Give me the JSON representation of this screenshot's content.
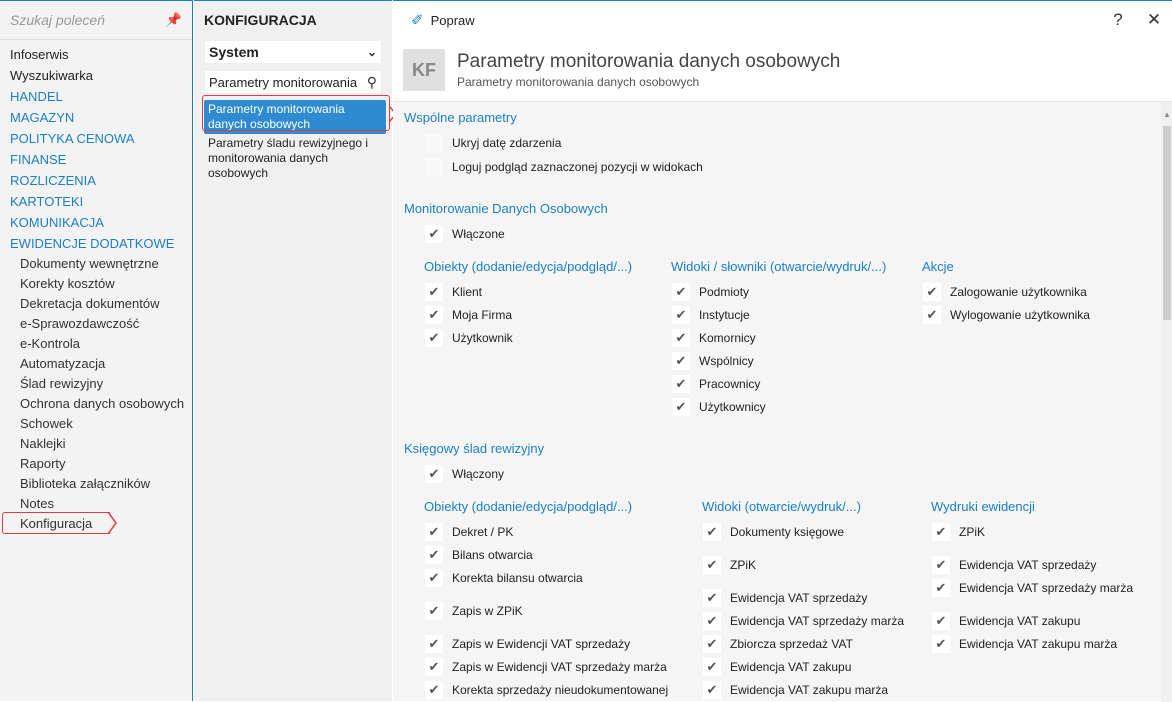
{
  "left": {
    "search_placeholder": "Szukaj poleceń",
    "items": [
      {
        "label": "Infoserwis",
        "type": "plain"
      },
      {
        "label": "Wyszukiwarka",
        "type": "plain"
      },
      {
        "label": "HANDEL",
        "type": "cat"
      },
      {
        "label": "MAGAZYN",
        "type": "cat"
      },
      {
        "label": "POLITYKA CENOWA",
        "type": "cat"
      },
      {
        "label": "FINANSE",
        "type": "cat"
      },
      {
        "label": "ROZLICZENIA",
        "type": "cat"
      },
      {
        "label": "KARTOTEKI",
        "type": "cat"
      },
      {
        "label": "KOMUNIKACJA",
        "type": "cat"
      },
      {
        "label": "EWIDENCJE DODATKOWE",
        "type": "cat"
      },
      {
        "label": "Dokumenty wewnętrzne",
        "type": "sub"
      },
      {
        "label": "Korekty kosztów",
        "type": "sub"
      },
      {
        "label": "Dekretacja dokumentów",
        "type": "sub"
      },
      {
        "label": "e-Sprawozdawczość",
        "type": "sub"
      },
      {
        "label": "e-Kontrola",
        "type": "sub"
      },
      {
        "label": "Automatyzacja",
        "type": "sub"
      },
      {
        "label": "Ślad rewizyjny",
        "type": "sub"
      },
      {
        "label": "Ochrona danych osobowych",
        "type": "sub"
      },
      {
        "label": "Schowek",
        "type": "sub"
      },
      {
        "label": "Naklejki",
        "type": "sub"
      },
      {
        "label": "Raporty",
        "type": "sub"
      },
      {
        "label": "Biblioteka załączników",
        "type": "sub"
      },
      {
        "label": "Notes",
        "type": "sub"
      },
      {
        "label": "Konfiguracja",
        "type": "sub"
      }
    ]
  },
  "mid": {
    "title": "KONFIGURACJA",
    "select_value": "System",
    "filter_value": "Parametry monitorowania",
    "nodes": [
      "Parametry monitorowania danych osobowych",
      "Parametry śladu rewizyjnego i monitorowania danych osobowych"
    ]
  },
  "toolbar": {
    "popraw": "Popraw",
    "help": "?",
    "close": "✕"
  },
  "header": {
    "badge": "KF",
    "title": "Parametry monitorowania danych osobowych",
    "subtitle": "Parametry monitorowania danych osobowych"
  },
  "sections": {
    "wspolne": "Wspólne parametry",
    "wspolne_opts": [
      "Ukryj datę zdarzenia",
      "Loguj podgląd zaznaczonej pozycji w widokach"
    ],
    "monitorowanie": "Monitorowanie Danych Osobowych",
    "wlaczone": "Włączone",
    "obiekty1": "Obiekty (dodanie/edycja/podgląd/...)",
    "obiekty1_items": [
      "Klient",
      "Moja Firma",
      "Użytkownik"
    ],
    "widoki1": "Widoki / słowniki (otwarcie/wydruk/...)",
    "widoki1_items": [
      "Podmioty",
      "Instytucje",
      "Komornicy",
      "Wspólnicy",
      "Pracownicy",
      "Użytkownicy"
    ],
    "akcje": "Akcje",
    "akcje_items": [
      "Zalogowanie użytkownika",
      "Wylogowanie użytkownika"
    ],
    "ksiegowy": "Księgowy ślad rewizyjny",
    "wlaczony": "Włączony",
    "obiekty2": "Obiekty (dodanie/edycja/podgląd/...)",
    "obiekty2_items": [
      "Dekret / PK",
      "Bilans otwarcia",
      "Korekta bilansu otwarcia",
      "Zapis w ZPiK",
      "Zapis w Ewidencji VAT sprzedaży",
      "Zapis w Ewidencji VAT sprzedaży marża",
      "Korekta sprzedaży nieudokumentowanej"
    ],
    "widoki2": "Widoki (otwarcie/wydruk/...)",
    "widoki2_items": [
      "Dokumenty księgowe",
      "ZPiK",
      "Ewidencja VAT sprzedaży",
      "Ewidencja VAT sprzedaży marża",
      "Zbiorcza sprzedaż VAT",
      "Ewidencja VAT zakupu",
      "Ewidencja VAT zakupu marża"
    ],
    "wydruki": "Wydruki ewidencji",
    "wydruki_items": [
      "ZPiK",
      "Ewidencja VAT sprzedaży",
      "Ewidencja VAT sprzedaży marża",
      "Ewidencja VAT zakupu",
      "Ewidencja VAT zakupu marża"
    ]
  },
  "colors": {
    "accent": "#1b7fc4",
    "selected": "#2f8bd1",
    "highlight": "#e53a40"
  }
}
